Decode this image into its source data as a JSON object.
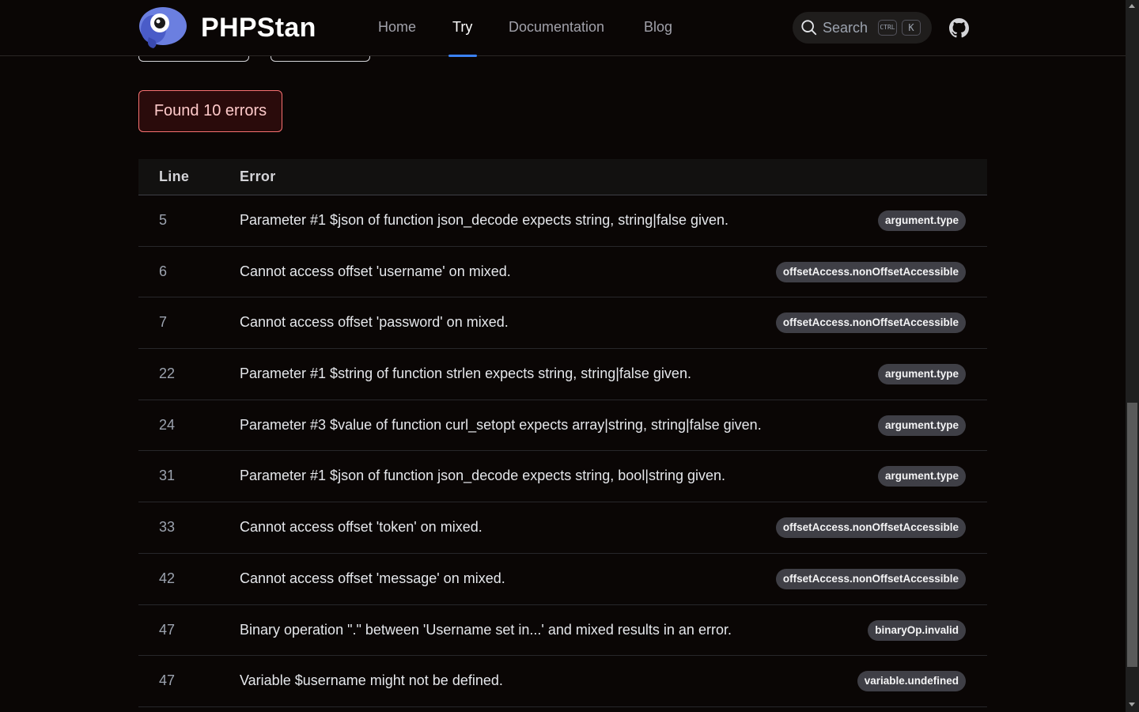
{
  "header": {
    "brand": "PHPStan",
    "nav": [
      {
        "label": "Home",
        "active": false
      },
      {
        "label": "Try",
        "active": true
      },
      {
        "label": "Documentation",
        "active": false
      },
      {
        "label": "Blog",
        "active": false
      }
    ],
    "search": {
      "label": "Search",
      "kbd_ctrl": "CTRL",
      "kbd_k": "K"
    },
    "github_icon": "github-icon"
  },
  "result": {
    "summary": "Found 10 errors"
  },
  "table": {
    "columns": [
      "Line",
      "Error"
    ],
    "rows": [
      {
        "line": "5",
        "error": "Parameter #1 $json of function json_decode expects string, string|false given.",
        "tag": "argument.type"
      },
      {
        "line": "6",
        "error": "Cannot access offset 'username' on mixed.",
        "tag": "offsetAccess.nonOffsetAccessible"
      },
      {
        "line": "7",
        "error": "Cannot access offset 'password' on mixed.",
        "tag": "offsetAccess.nonOffsetAccessible"
      },
      {
        "line": "22",
        "error": "Parameter #1 $string of function strlen expects string, string|false given.",
        "tag": "argument.type"
      },
      {
        "line": "24",
        "error": "Parameter #3 $value of function curl_setopt expects array|string, string|false given.",
        "tag": "argument.type"
      },
      {
        "line": "31",
        "error": "Parameter #1 $json of function json_decode expects string, bool|string given.",
        "tag": "argument.type"
      },
      {
        "line": "33",
        "error": "Cannot access offset 'token' on mixed.",
        "tag": "offsetAccess.nonOffsetAccessible"
      },
      {
        "line": "42",
        "error": "Cannot access offset 'message' on mixed.",
        "tag": "offsetAccess.nonOffsetAccessible"
      },
      {
        "line": "47",
        "error": "Binary operation \".\" between 'Username set in...' and mixed results in an error.",
        "tag": "binaryOp.invalid"
      },
      {
        "line": "47",
        "error": "Variable $username might not be defined.",
        "tag": "variable.undefined"
      }
    ]
  },
  "colors": {
    "background": "#0a0605",
    "accent": "#3b82f6",
    "error_border": "#f87171",
    "tag_bg": "#3f3f46"
  }
}
